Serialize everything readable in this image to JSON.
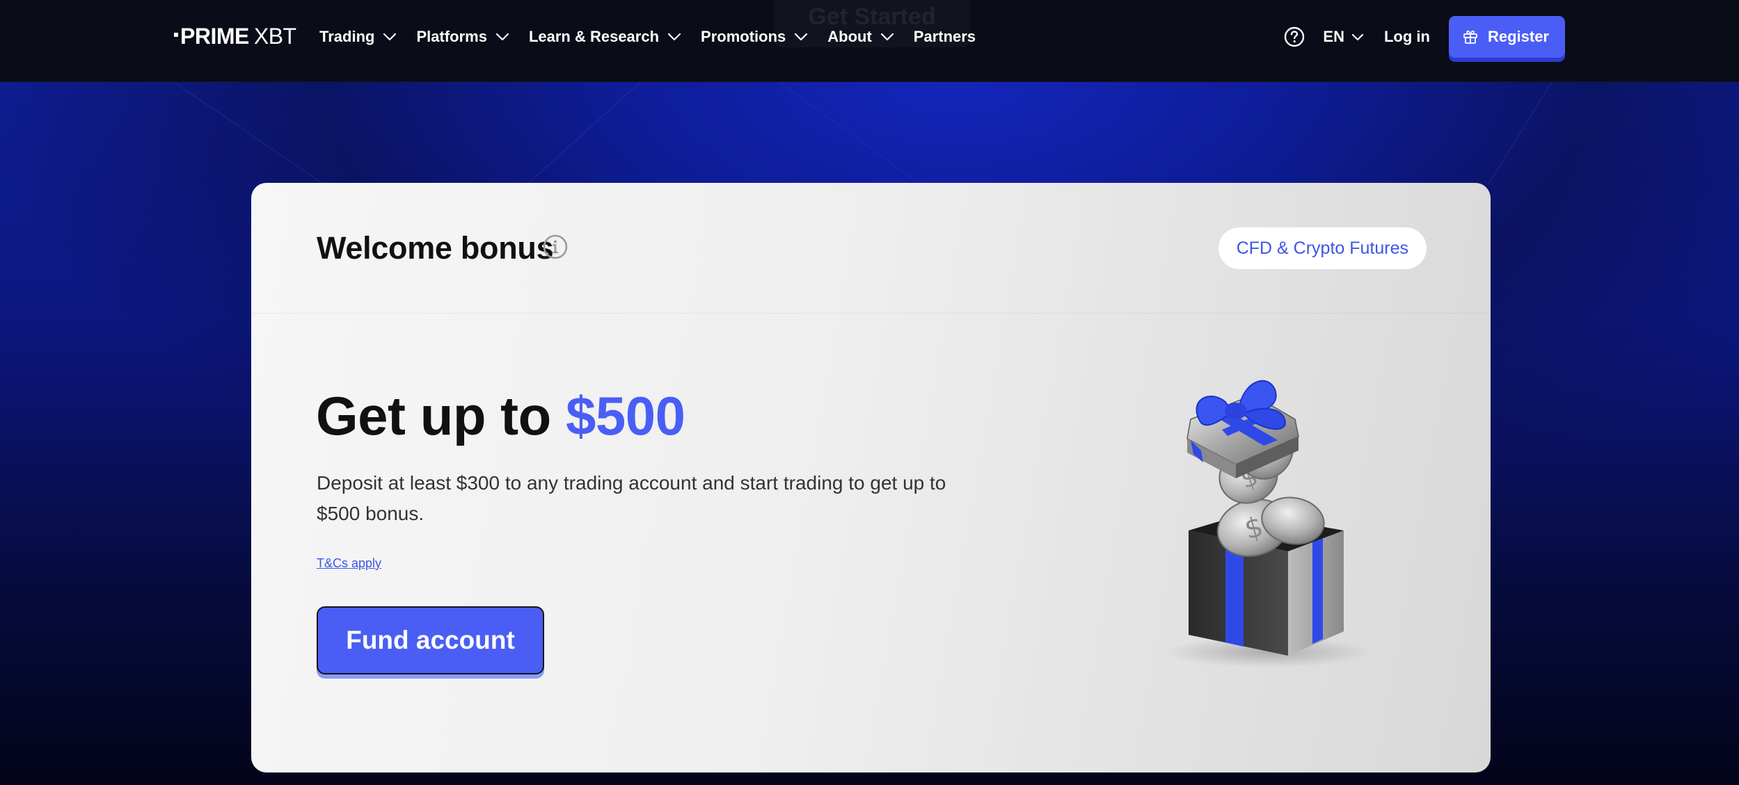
{
  "header": {
    "logo": {
      "prime": "PRIME",
      "xbt": "XBT"
    },
    "ghost_label": "Get Started",
    "nav": [
      {
        "label": "Trading",
        "has_dropdown": true
      },
      {
        "label": "Platforms",
        "has_dropdown": true
      },
      {
        "label": "Learn & Research",
        "has_dropdown": true
      },
      {
        "label": "Promotions",
        "has_dropdown": true
      },
      {
        "label": "About",
        "has_dropdown": true
      },
      {
        "label": "Partners",
        "has_dropdown": false
      }
    ],
    "help_icon": "question-circle-icon",
    "language": "EN",
    "login_label": "Log in",
    "register_label": "Register",
    "register_icon": "gift-icon"
  },
  "card": {
    "title": "Welcome bonus",
    "info_icon": "info-circle-icon",
    "tag": "CFD & Crypto Futures",
    "headline_prefix": "Get up to",
    "headline_amount": "$500",
    "description": "Deposit at least $300 to any trading account and start trading to get up to $500 bonus.",
    "tcs_link": "T&Cs apply",
    "cta_label": "Fund account",
    "illustration": "gift-box-with-coins"
  },
  "colors": {
    "accent": "#4a5ef6",
    "header_bg": "#0a0c17",
    "page_bg": "#0f1f9a",
    "card_bg": "#efefef",
    "link": "#3d55e8"
  }
}
